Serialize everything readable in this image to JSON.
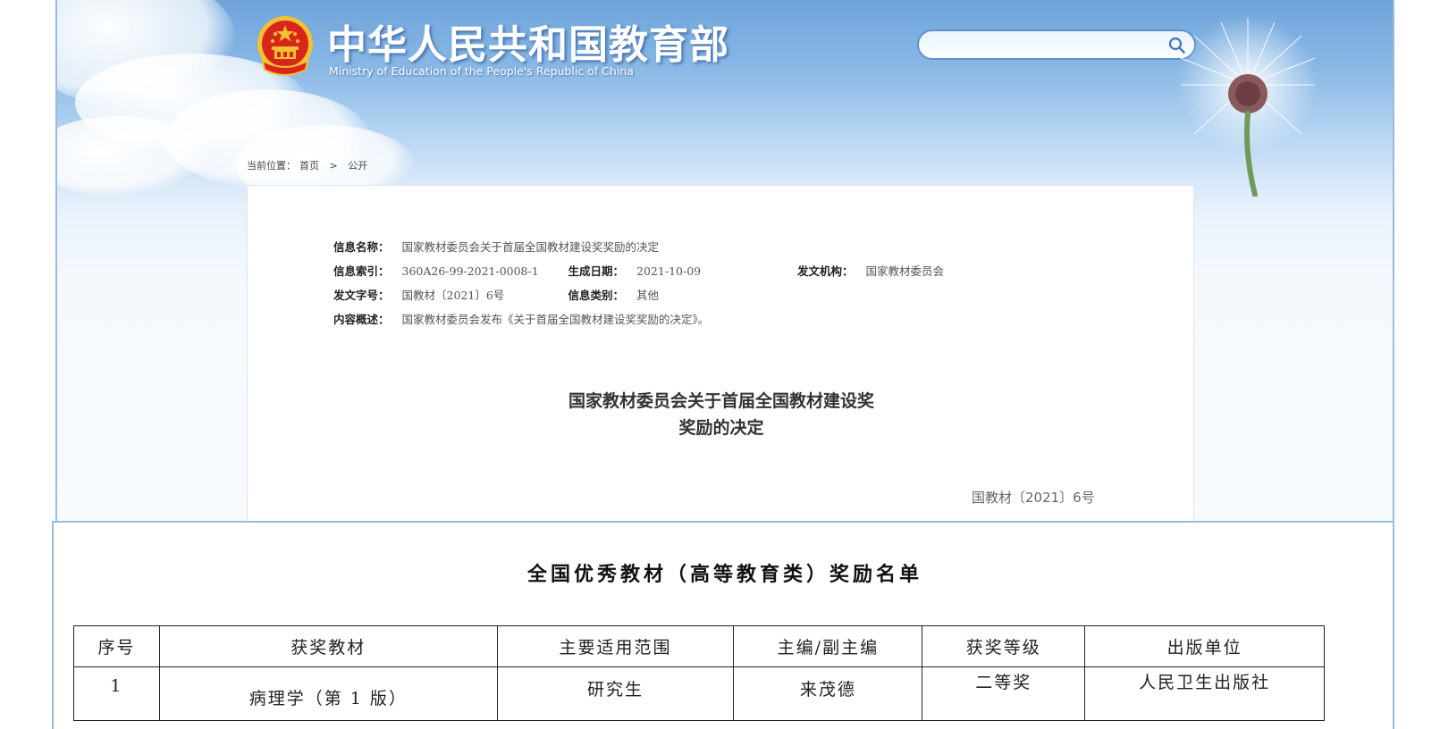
{
  "header": {
    "site_title": "中华人民共和国教育部",
    "site_subtitle": "Ministry of Education of the People's Republic of China",
    "search_placeholder": ""
  },
  "breadcrumb": {
    "prefix": "当前位置：",
    "home": "首页",
    "separator": ">",
    "current": "公开"
  },
  "document": {
    "meta": {
      "name_label": "信息名称：",
      "name_value": "国家教材委员会关于首届全国教材建设奖奖励的决定",
      "index_label": "信息索引：",
      "index_value": "360A26-99-2021-0008-1",
      "date_label": "生成日期：",
      "date_value": "2021-10-09",
      "org_label": "发文机构：",
      "org_value": "国家教材委员会",
      "doc_no_label": "发文字号：",
      "doc_no_value": "国教材〔2021〕6号",
      "category_label": "信息类别：",
      "category_value": "其他",
      "summary_label": "内容概述：",
      "summary_value": "国家教材委员会发布《关于首届全国教材建设奖奖励的决定》。"
    },
    "heading_line1": "国家教材委员会关于首届全国教材建设奖",
    "heading_line2": "奖励的决定",
    "doc_number": "国教材〔2021〕6号"
  },
  "award_list": {
    "title": "全国优秀教材（高等教育类）奖励名单",
    "columns": [
      "序号",
      "获奖教材",
      "主要适用范围",
      "主编/副主编",
      "获奖等级",
      "出版单位"
    ],
    "rows": [
      [
        "1",
        "病理学（第 1 版）",
        "研究生",
        "来茂德",
        "二等奖",
        "人民卫生出版社"
      ]
    ]
  },
  "colors": {
    "sky_top": "#6fa4db",
    "border_blue": "#9cb9de",
    "search_border": "#5e93cf",
    "emblem_red": "#d8261c",
    "emblem_gold": "#f2c230"
  }
}
